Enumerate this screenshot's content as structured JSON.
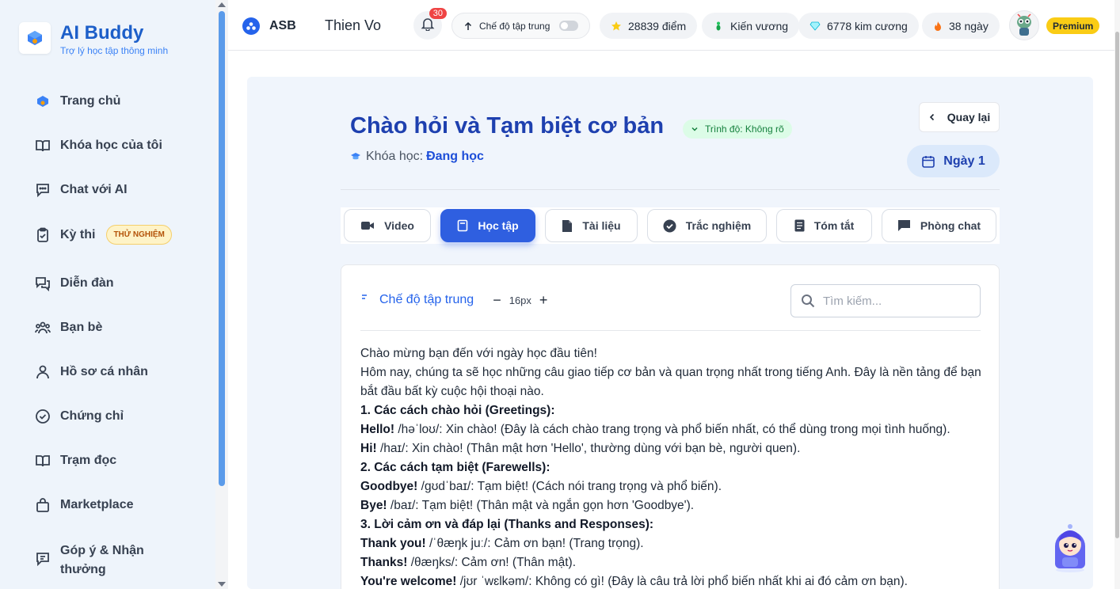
{
  "brand": {
    "name": "AI Buddy",
    "subtitle": "Trợ lý học tập thông minh"
  },
  "sidebar": {
    "items": [
      {
        "label": "Trang chủ",
        "icon": "home-logo-icon"
      },
      {
        "label": "Khóa học của tôi",
        "icon": "book-open-icon"
      },
      {
        "label": "Chat với AI",
        "icon": "chat-icon"
      },
      {
        "label": "Kỳ thi",
        "icon": "clipboard-check-icon",
        "badge": "THỬ NGHIỆM"
      },
      {
        "label": "Diễn đàn",
        "icon": "forum-icon"
      },
      {
        "label": "Bạn bè",
        "icon": "users-icon"
      },
      {
        "label": "Hồ sơ cá nhân",
        "icon": "user-icon"
      },
      {
        "label": "Chứng chỉ",
        "icon": "check-circle-icon"
      },
      {
        "label": "Trạm đọc",
        "icon": "book-icon"
      },
      {
        "label": "Marketplace",
        "icon": "bag-icon"
      },
      {
        "label": "Góp ý & Nhận thưởng",
        "icon": "feedback-icon"
      }
    ]
  },
  "topbar": {
    "org": "ASB",
    "user_name": "Thien Vo",
    "notification_count": "30",
    "focus_mode_label": "Chế độ tập trung",
    "points": "28839 điểm",
    "rank": "Kiến vương",
    "diamonds": "6778 kim cương",
    "streak": "38 ngày",
    "premium": "Premium"
  },
  "lesson": {
    "title": "Chào hỏi và Tạm biệt cơ bản",
    "level": "Trình độ: Không rõ",
    "course_label": "Khóa học:",
    "course_value": "Đang học",
    "back_label": "Quay lại",
    "day_label": "Ngày 1"
  },
  "tabs": [
    {
      "label": "Video",
      "icon": "video-icon"
    },
    {
      "label": "Học tập",
      "icon": "study-icon",
      "active": true
    },
    {
      "label": "Tài liệu",
      "icon": "document-icon"
    },
    {
      "label": "Trắc nghiệm",
      "icon": "quiz-check-icon"
    },
    {
      "label": "Tóm tắt",
      "icon": "summary-icon"
    },
    {
      "label": "Phòng chat",
      "icon": "chat-room-icon"
    }
  ],
  "content": {
    "focus_mode": "Chế độ tập trung",
    "font_size": "16px",
    "search_placeholder": "Tìm kiếm...",
    "lines": [
      {
        "text": "Chào mừng bạn đến với ngày học đầu tiên!"
      },
      {
        "text": "Hôm nay, chúng ta sẽ học những câu giao tiếp cơ bản và quan trọng nhất trong tiếng Anh. Đây là nền tảng để bạn bắt đầu bất kỳ cuộc hội thoại nào."
      },
      {
        "bold": "1. Các cách chào hỏi (Greetings):"
      },
      {
        "bold": "Hello!",
        "text": " /həˈloʊ/: Xin chào! (Đây là cách chào trang trọng và phổ biến nhất, có thể dùng trong mọi tình huống)."
      },
      {
        "bold": "Hi!",
        "text": " /haɪ/: Xin chào! (Thân mật hơn 'Hello', thường dùng với bạn bè, người quen)."
      },
      {
        "bold": "2. Các cách tạm biệt (Farewells):"
      },
      {
        "bold": "Goodbye!",
        "text": " /ɡʊdˈbaɪ/: Tạm biệt! (Cách nói trang trọng và phổ biến)."
      },
      {
        "bold": "Bye!",
        "text": " /baɪ/: Tạm biệt! (Thân mật và ngắn gọn hơn 'Goodbye')."
      },
      {
        "bold": "3. Lời cảm ơn và đáp lại (Thanks and Responses):"
      },
      {
        "bold": "Thank you!",
        "text": " /ˈθæŋk juː/: Cảm ơn bạn! (Trang trọng)."
      },
      {
        "bold": "Thanks!",
        "text": " /θæŋks/: Cảm ơn! (Thân mật)."
      },
      {
        "bold": "You're welcome!",
        "text": " /jʊr ˈwɛlkəm/: Không có gì! (Đây là câu trả lời phổ biến nhất khi ai đó cảm ơn bạn)."
      }
    ]
  },
  "colors": {
    "primary": "#2f5fe0",
    "brand": "#1d5fc9",
    "premium": "#facc15",
    "badge_red": "#ef4444"
  }
}
